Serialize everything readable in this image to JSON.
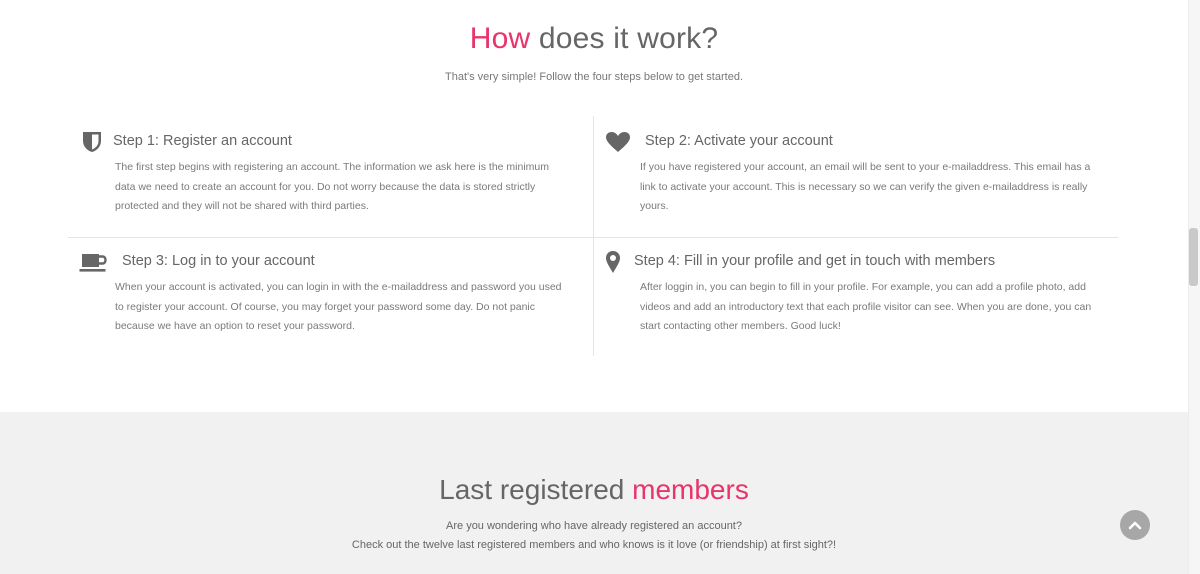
{
  "how": {
    "title_accent": "How",
    "title_rest": " does it work?",
    "subtitle": "That's very simple! Follow the four steps below to get started."
  },
  "steps": [
    {
      "icon": "shield-icon",
      "title": "Step 1: Register an account",
      "body": "The first step begins with registering an account. The information we ask here is the minimum data we need to create an account for you. Do not worry because the data is stored strictly protected and they will not be shared with third parties."
    },
    {
      "icon": "heart-icon",
      "title": "Step 2: Activate your account",
      "body": "If you have registered your account, an email will be sent to your e-mailaddress. This email has a link to activate your account. This is necessary so we can verify the given e-mailaddress is really yours."
    },
    {
      "icon": "coffee-cup-icon",
      "title": "Step 3: Log in to your account",
      "body": "When your account is activated, you can login in with the e-mailaddress and password you used to register your account. Of course, you may forget your password some day. Do not panic because we have an option to reset your password."
    },
    {
      "icon": "map-marker-icon",
      "title": "Step 4: Fill in your profile and get in touch with members",
      "body": "After loggin in, you can begin to fill in your profile. For example, you can add a profile photo, add videos and add an introductory text that each profile visitor can see. When you are done, you can start contacting other members. Good luck!"
    }
  ],
  "members": {
    "title_rest": "Last registered ",
    "title_accent": "members",
    "line1": "Are you wondering who have already registered an account?",
    "line2": "Check out the twelve last registered members and who knows is it love (or friendship) at first sight?!"
  },
  "back_to_top": {
    "icon": "chevron-up-icon"
  },
  "colors": {
    "accent": "#e8336b",
    "heading": "#666666",
    "body_text": "#7a7a7a",
    "members_bg": "#f1f1f1",
    "back_to_top_bg": "#a7a7a7"
  }
}
